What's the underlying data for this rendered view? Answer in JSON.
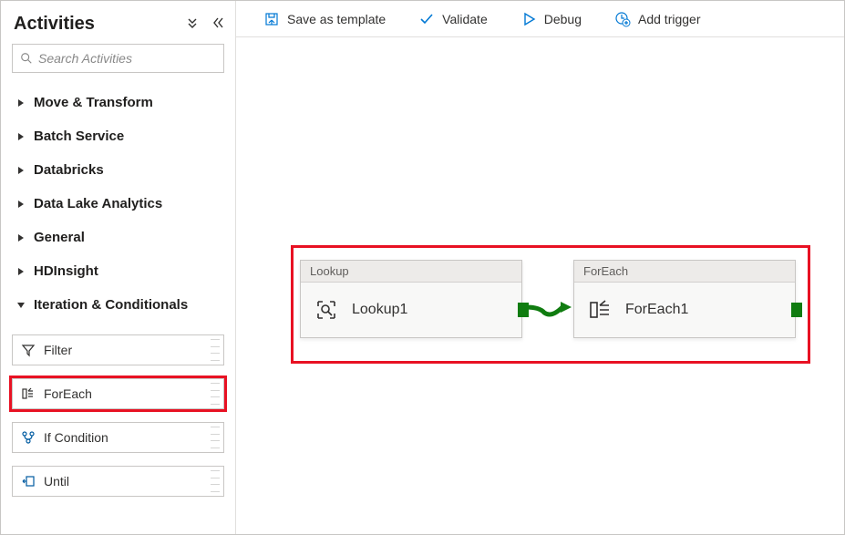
{
  "sidebar": {
    "title": "Activities",
    "search_placeholder": "Search Activities",
    "categories": [
      {
        "label": "Move & Transform",
        "expanded": false
      },
      {
        "label": "Batch Service",
        "expanded": false
      },
      {
        "label": "Databricks",
        "expanded": false
      },
      {
        "label": "Data Lake Analytics",
        "expanded": false
      },
      {
        "label": "General",
        "expanded": false
      },
      {
        "label": "HDInsight",
        "expanded": false
      },
      {
        "label": "Iteration & Conditionals",
        "expanded": true
      }
    ],
    "iteration_items": [
      {
        "name": "Filter",
        "highlight": false
      },
      {
        "name": "ForEach",
        "highlight": true
      },
      {
        "name": "If Condition",
        "highlight": false
      },
      {
        "name": "Until",
        "highlight": false
      }
    ]
  },
  "toolbar": {
    "save_template": "Save as template",
    "validate": "Validate",
    "debug": "Debug",
    "add_trigger": "Add trigger"
  },
  "canvas": {
    "nodes": [
      {
        "id": "lookup",
        "type_label": "Lookup",
        "name": "Lookup1"
      },
      {
        "id": "foreach",
        "type_label": "ForEach",
        "name": "ForEach1"
      }
    ]
  }
}
